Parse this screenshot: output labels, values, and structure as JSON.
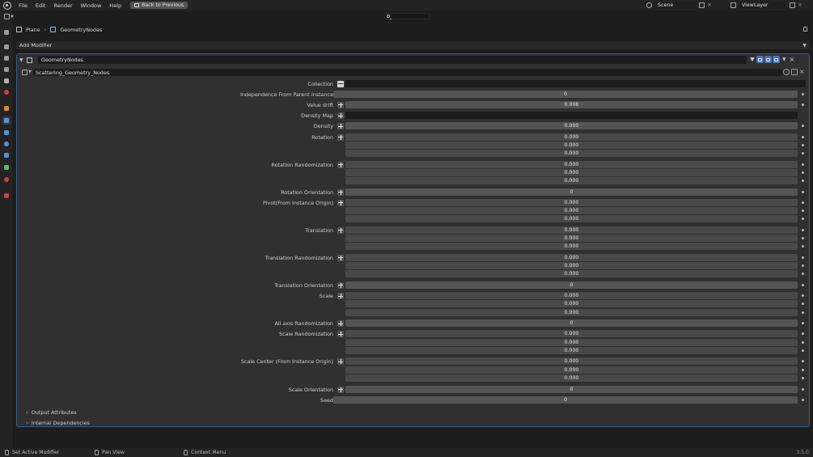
{
  "menubar": {
    "items": [
      "File",
      "Edit",
      "Render",
      "Window",
      "Help"
    ],
    "back_button": "Back to Previous",
    "scene": "Scene",
    "view_layer": "ViewLayer"
  },
  "breadcrumb": {
    "object": "Plane",
    "modifier": "GeometryNodes"
  },
  "add_modifier_label": "Add Modifier",
  "modifier": {
    "name": "GeometryNodes",
    "node_group": "Scattering_Geometry_Nodes"
  },
  "params": [
    {
      "label": "Collection",
      "kind": "collection",
      "values": [
        ""
      ]
    },
    {
      "label": "Independence From Parent Instance",
      "kind": "int",
      "values": [
        "0"
      ]
    },
    {
      "label": "Value drift",
      "kind": "float",
      "values": [
        "0.008"
      ]
    },
    {
      "label": "Density Map",
      "kind": "attribute",
      "values": [
        ""
      ]
    },
    {
      "label": "Density",
      "kind": "float",
      "values": [
        "0.000"
      ]
    },
    {
      "label": "Rotation",
      "kind": "vector",
      "values": [
        "0.000",
        "0.000",
        "0.000"
      ]
    },
    {
      "label": "Rotation Randomization",
      "kind": "vector",
      "values": [
        "0.000",
        "0.000",
        "0.000"
      ]
    },
    {
      "label": "Rotation Orientation",
      "kind": "float",
      "values": [
        "0"
      ]
    },
    {
      "label": "Pivot(From Instance Origin)",
      "kind": "vector",
      "values": [
        "0.000",
        "0.000",
        "0.000"
      ]
    },
    {
      "label": "Translation",
      "kind": "vector",
      "values": [
        "0.000",
        "0.000",
        "0.000"
      ]
    },
    {
      "label": "Translation Randomization",
      "kind": "vector",
      "values": [
        "0.000",
        "0.000",
        "0.000"
      ]
    },
    {
      "label": "Translation Orientation",
      "kind": "float",
      "values": [
        "0"
      ]
    },
    {
      "label": "Scale",
      "kind": "vector",
      "values": [
        "0.000",
        "0.000",
        "0.000"
      ]
    },
    {
      "label": "All axis Randomization",
      "kind": "float",
      "values": [
        "0"
      ]
    },
    {
      "label": "Scale Randomization",
      "kind": "vector",
      "values": [
        "0.000",
        "0.000",
        "0.000"
      ]
    },
    {
      "label": "Scale Center (From Instance Origin)",
      "kind": "vector",
      "values": [
        "0.000",
        "0.000",
        "0.000"
      ]
    },
    {
      "label": "Scale Orientation",
      "kind": "float",
      "values": [
        "0"
      ]
    },
    {
      "label": "Seed",
      "kind": "int",
      "values": [
        "0"
      ]
    }
  ],
  "subpanels": [
    "Output Attributes",
    "Internal Dependencies"
  ],
  "statusbar": {
    "hints": [
      "Set Active Modifier",
      "Pan View",
      "Context Menu"
    ],
    "version": "3.5.0"
  },
  "colors": {
    "active_border": "#3d5a85",
    "accent": "#4772b3"
  }
}
